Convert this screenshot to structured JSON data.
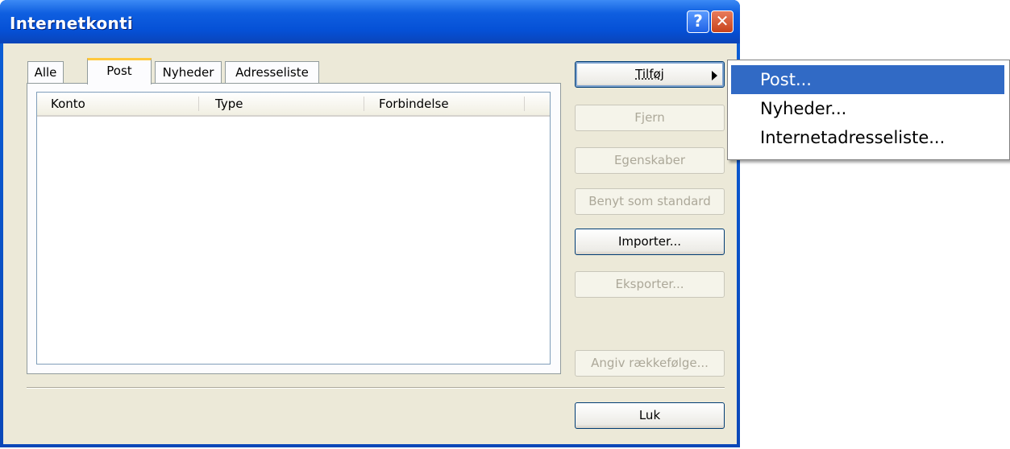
{
  "window": {
    "title": "Internetkonti",
    "help_label": "?",
    "close_label": "✕"
  },
  "tabs": [
    {
      "label": "Alle"
    },
    {
      "label": "Post"
    },
    {
      "label": "Nyheder"
    },
    {
      "label": "Adresseliste"
    }
  ],
  "list": {
    "columns": [
      "Konto",
      "Type",
      "Forbindelse"
    ],
    "rows": []
  },
  "buttons": {
    "add": "Tilføj",
    "remove": "Fjern",
    "properties": "Egenskaber",
    "set_default": "Benyt som standard",
    "import": "Importer...",
    "export": "Eksporter...",
    "set_order": "Angiv rækkefølge...",
    "close": "Luk"
  },
  "menu": {
    "items": [
      "Post...",
      "Nyheder...",
      "Internetadresseliste..."
    ]
  },
  "colors": {
    "title_bar": "#0550d6",
    "dialog_bg": "#ece9d8",
    "menu_highlight": "#316ac5",
    "active_tab_accent": "#ffc83c"
  }
}
